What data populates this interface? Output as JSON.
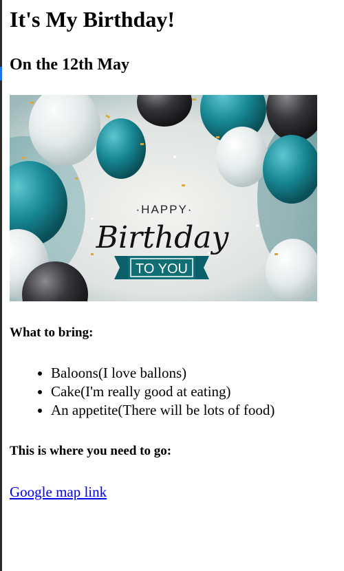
{
  "page": {
    "title": "It's My Birthday!",
    "subtitle": "On the 12th May"
  },
  "banner": {
    "happy_text": "·HAPPY·",
    "birthday_text": "Birthday",
    "to_you_text": "TO YOU",
    "colors": {
      "teal": "#1a8a96",
      "teal_dark": "#0b5f68",
      "balloon_dark": "#2f2f33",
      "background": "#e9ecea",
      "ribbon": "#0f6f75"
    }
  },
  "bring": {
    "heading": "What to bring:",
    "items": [
      "Baloons(I love ballons)",
      "Cake(I'm really good at eating)",
      "An appetite(There will be lots of food)"
    ]
  },
  "directions": {
    "heading": "This is where you need to go:",
    "link_text": "Google map link"
  }
}
